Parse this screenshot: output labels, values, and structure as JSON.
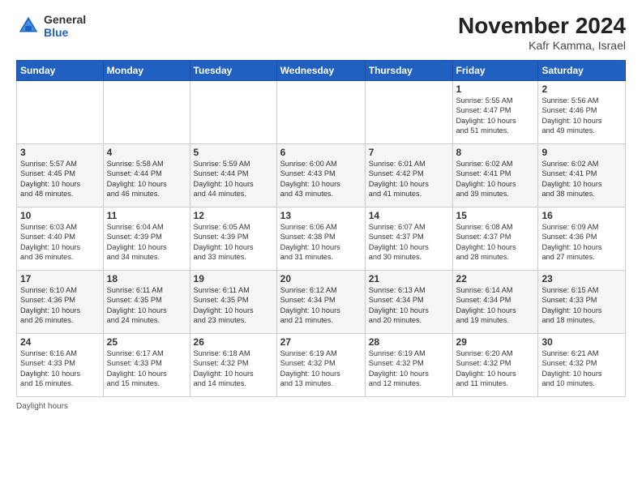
{
  "header": {
    "logo_general": "General",
    "logo_blue": "Blue",
    "month_title": "November 2024",
    "location": "Kafr Kamma, Israel"
  },
  "weekdays": [
    "Sunday",
    "Monday",
    "Tuesday",
    "Wednesday",
    "Thursday",
    "Friday",
    "Saturday"
  ],
  "weeks": [
    [
      {
        "day": "",
        "info": ""
      },
      {
        "day": "",
        "info": ""
      },
      {
        "day": "",
        "info": ""
      },
      {
        "day": "",
        "info": ""
      },
      {
        "day": "",
        "info": ""
      },
      {
        "day": "1",
        "info": "Sunrise: 5:55 AM\nSunset: 4:47 PM\nDaylight: 10 hours\nand 51 minutes."
      },
      {
        "day": "2",
        "info": "Sunrise: 5:56 AM\nSunset: 4:46 PM\nDaylight: 10 hours\nand 49 minutes."
      }
    ],
    [
      {
        "day": "3",
        "info": "Sunrise: 5:57 AM\nSunset: 4:45 PM\nDaylight: 10 hours\nand 48 minutes."
      },
      {
        "day": "4",
        "info": "Sunrise: 5:58 AM\nSunset: 4:44 PM\nDaylight: 10 hours\nand 46 minutes."
      },
      {
        "day": "5",
        "info": "Sunrise: 5:59 AM\nSunset: 4:44 PM\nDaylight: 10 hours\nand 44 minutes."
      },
      {
        "day": "6",
        "info": "Sunrise: 6:00 AM\nSunset: 4:43 PM\nDaylight: 10 hours\nand 43 minutes."
      },
      {
        "day": "7",
        "info": "Sunrise: 6:01 AM\nSunset: 4:42 PM\nDaylight: 10 hours\nand 41 minutes."
      },
      {
        "day": "8",
        "info": "Sunrise: 6:02 AM\nSunset: 4:41 PM\nDaylight: 10 hours\nand 39 minutes."
      },
      {
        "day": "9",
        "info": "Sunrise: 6:02 AM\nSunset: 4:41 PM\nDaylight: 10 hours\nand 38 minutes."
      }
    ],
    [
      {
        "day": "10",
        "info": "Sunrise: 6:03 AM\nSunset: 4:40 PM\nDaylight: 10 hours\nand 36 minutes."
      },
      {
        "day": "11",
        "info": "Sunrise: 6:04 AM\nSunset: 4:39 PM\nDaylight: 10 hours\nand 34 minutes."
      },
      {
        "day": "12",
        "info": "Sunrise: 6:05 AM\nSunset: 4:39 PM\nDaylight: 10 hours\nand 33 minutes."
      },
      {
        "day": "13",
        "info": "Sunrise: 6:06 AM\nSunset: 4:38 PM\nDaylight: 10 hours\nand 31 minutes."
      },
      {
        "day": "14",
        "info": "Sunrise: 6:07 AM\nSunset: 4:37 PM\nDaylight: 10 hours\nand 30 minutes."
      },
      {
        "day": "15",
        "info": "Sunrise: 6:08 AM\nSunset: 4:37 PM\nDaylight: 10 hours\nand 28 minutes."
      },
      {
        "day": "16",
        "info": "Sunrise: 6:09 AM\nSunset: 4:36 PM\nDaylight: 10 hours\nand 27 minutes."
      }
    ],
    [
      {
        "day": "17",
        "info": "Sunrise: 6:10 AM\nSunset: 4:36 PM\nDaylight: 10 hours\nand 26 minutes."
      },
      {
        "day": "18",
        "info": "Sunrise: 6:11 AM\nSunset: 4:35 PM\nDaylight: 10 hours\nand 24 minutes."
      },
      {
        "day": "19",
        "info": "Sunrise: 6:11 AM\nSunset: 4:35 PM\nDaylight: 10 hours\nand 23 minutes."
      },
      {
        "day": "20",
        "info": "Sunrise: 6:12 AM\nSunset: 4:34 PM\nDaylight: 10 hours\nand 21 minutes."
      },
      {
        "day": "21",
        "info": "Sunrise: 6:13 AM\nSunset: 4:34 PM\nDaylight: 10 hours\nand 20 minutes."
      },
      {
        "day": "22",
        "info": "Sunrise: 6:14 AM\nSunset: 4:34 PM\nDaylight: 10 hours\nand 19 minutes."
      },
      {
        "day": "23",
        "info": "Sunrise: 6:15 AM\nSunset: 4:33 PM\nDaylight: 10 hours\nand 18 minutes."
      }
    ],
    [
      {
        "day": "24",
        "info": "Sunrise: 6:16 AM\nSunset: 4:33 PM\nDaylight: 10 hours\nand 16 minutes."
      },
      {
        "day": "25",
        "info": "Sunrise: 6:17 AM\nSunset: 4:33 PM\nDaylight: 10 hours\nand 15 minutes."
      },
      {
        "day": "26",
        "info": "Sunrise: 6:18 AM\nSunset: 4:32 PM\nDaylight: 10 hours\nand 14 minutes."
      },
      {
        "day": "27",
        "info": "Sunrise: 6:19 AM\nSunset: 4:32 PM\nDaylight: 10 hours\nand 13 minutes."
      },
      {
        "day": "28",
        "info": "Sunrise: 6:19 AM\nSunset: 4:32 PM\nDaylight: 10 hours\nand 12 minutes."
      },
      {
        "day": "29",
        "info": "Sunrise: 6:20 AM\nSunset: 4:32 PM\nDaylight: 10 hours\nand 11 minutes."
      },
      {
        "day": "30",
        "info": "Sunrise: 6:21 AM\nSunset: 4:32 PM\nDaylight: 10 hours\nand 10 minutes."
      }
    ]
  ],
  "footer": {
    "note": "Daylight hours"
  }
}
